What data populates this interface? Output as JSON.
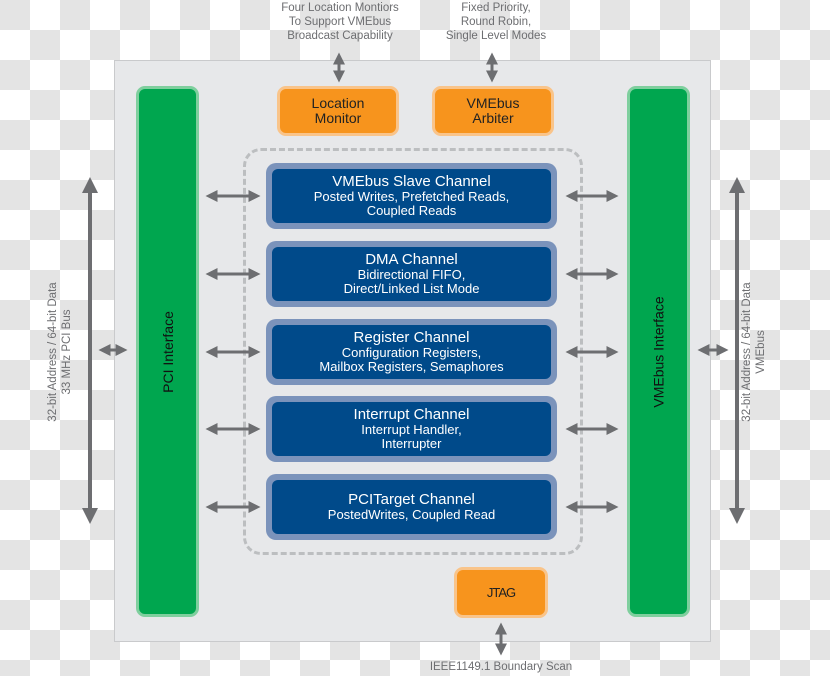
{
  "diagram": {
    "top_notes": {
      "location_monitor": [
        "Four Location Montiors",
        "To Support VMEbus",
        "Broadcast Capability"
      ],
      "arbiter": [
        "Fixed Priority,",
        "Round Robin,",
        "Single Level Modes"
      ]
    },
    "bottom_note": "IEEE1149.1 Boundary Scan",
    "left_bus_note": [
      "32-bit Address / 64-bit Data",
      "33 MHz PCI Bus"
    ],
    "right_bus_note": [
      "32-bit Address / 64-bit Data",
      "VMEbus"
    ],
    "left_interface": "PCI Interface",
    "right_interface": "VMEbus Interface",
    "orange_blocks": {
      "location_monitor": [
        "Location",
        "Monitor"
      ],
      "arbiter": [
        "VMEbus",
        "Arbiter"
      ],
      "jtag": "JTAG"
    },
    "channels": [
      {
        "title": "VMEbus Slave Channel",
        "lines": [
          "Posted Writes, Prefetched Reads,",
          "Coupled Reads"
        ]
      },
      {
        "title": "DMA Channel",
        "lines": [
          "Bidirectional FIFO,",
          "Direct/Linked List Mode"
        ]
      },
      {
        "title": "Register Channel",
        "lines": [
          "Configuration Registers,",
          "Mailbox Registers, Semaphores"
        ]
      },
      {
        "title": "Interrupt Channel",
        "lines": [
          "Interrupt Handler,",
          "Interrupter"
        ]
      },
      {
        "title": "PCITarget Channel",
        "lines": [
          "PostedWrites, Coupled Read"
        ]
      }
    ],
    "colors": {
      "interface_green": "#00a64f",
      "block_orange": "#f7941d",
      "channel_blue": "#004a8a",
      "channel_border": "#7b93bb",
      "arrow_grey": "#6d6e71"
    }
  }
}
